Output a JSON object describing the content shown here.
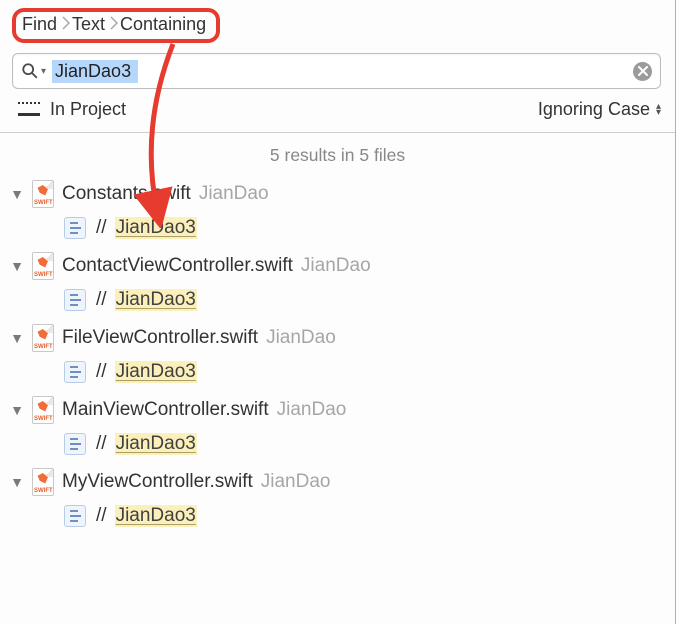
{
  "breadcrumb": {
    "items": [
      "Find",
      "Text",
      "Containing"
    ]
  },
  "search": {
    "query": "JianDao3"
  },
  "scope": {
    "label": "In Project",
    "caseLabel": "Ignoring Case"
  },
  "summary": "5 results in 5 files",
  "matchToken": "JianDao3",
  "commentPrefix": "//",
  "projectName": "JianDao",
  "swiftBadge": "SWIFT",
  "results": [
    {
      "file": "Constants.swift"
    },
    {
      "file": "ContactViewController.swift"
    },
    {
      "file": "FileViewController.swift"
    },
    {
      "file": "MainViewController.swift"
    },
    {
      "file": "MyViewController.swift"
    }
  ]
}
